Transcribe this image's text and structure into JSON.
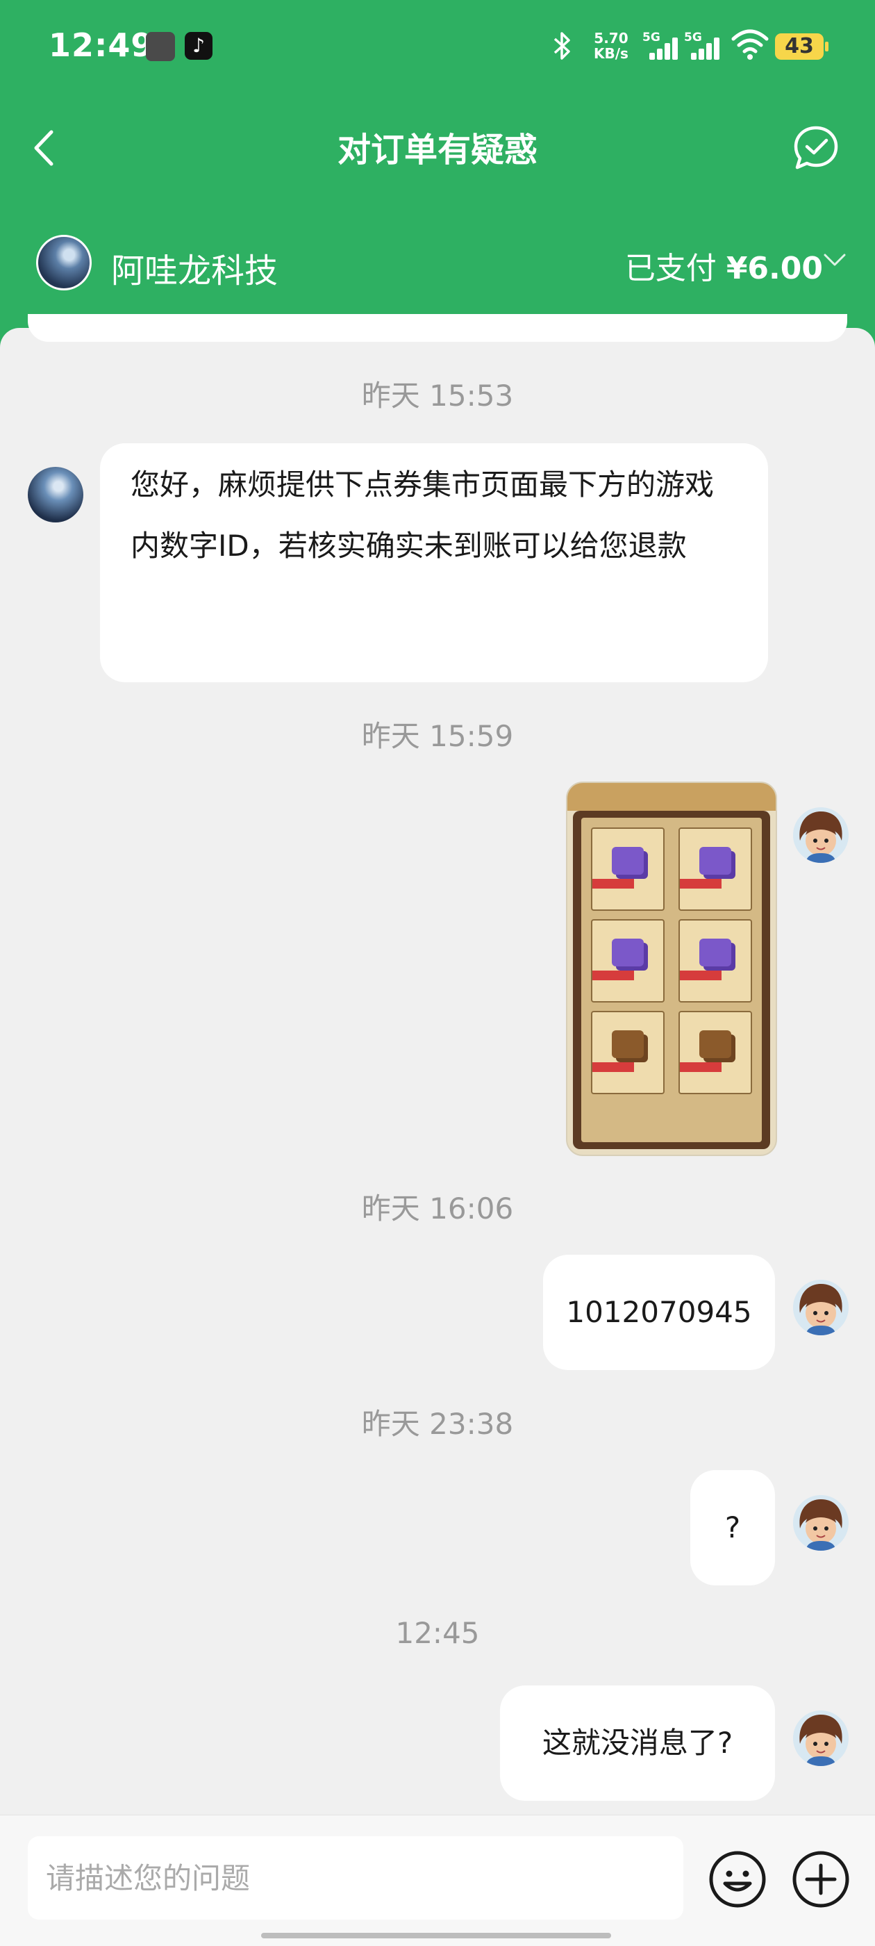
{
  "status_bar": {
    "time": "12:49",
    "net_speed_value": "5.70",
    "net_speed_unit": "KB/s",
    "signal_label_1": "5G",
    "signal_label_2": "5G",
    "battery": "43"
  },
  "header": {
    "title": "对订单有疑惑",
    "merchant_name": "阿哇龙科技",
    "payment_status": "已支付",
    "payment_amount": "¥6.00"
  },
  "messages": [
    {
      "timestamp": "昨天 15:53",
      "sender": "merchant",
      "text": "您好，麻烦提供下点券集市页面最下方的游戏内数字ID，若核实确实未到账可以给您退款"
    },
    {
      "timestamp": "昨天 15:59",
      "sender": "user",
      "type": "image"
    },
    {
      "timestamp": "昨天 16:06",
      "sender": "user",
      "text": "1012070945"
    },
    {
      "timestamp": "昨天 23:38",
      "sender": "user",
      "text": "?"
    },
    {
      "timestamp": "12:45",
      "sender": "user",
      "text": "这就没消息了?"
    }
  ],
  "input_bar": {
    "placeholder": "请描述您的问题"
  },
  "colors": {
    "brand_green": "#2eb062",
    "background": "#f0f0f0",
    "bubble": "#ffffff",
    "timestamp": "#999999"
  },
  "icons": [
    "back-arrow-icon",
    "feedback-check-icon",
    "chevron-down-icon",
    "emoji-icon",
    "plus-icon",
    "bluetooth-icon",
    "wifi-icon"
  ]
}
